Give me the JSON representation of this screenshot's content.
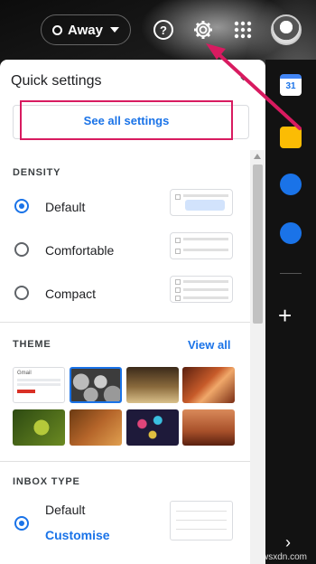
{
  "header": {
    "status_label": "Away",
    "icons": [
      "help-icon",
      "gear-icon",
      "apps-grid-icon",
      "avatar"
    ]
  },
  "side_strip": {
    "calendar_day": "31",
    "icons": [
      "calendar-icon",
      "keep-icon",
      "tasks-icon",
      "contacts-icon",
      "add-icon",
      "chevron-right-icon"
    ]
  },
  "quick_settings": {
    "title": "Quick settings",
    "see_all_label": "See all settings",
    "density": {
      "heading": "DENSITY",
      "options": [
        {
          "label": "Default",
          "selected": true
        },
        {
          "label": "Comfortable",
          "selected": false
        },
        {
          "label": "Compact",
          "selected": false
        }
      ]
    },
    "theme": {
      "heading": "THEME",
      "view_all_label": "View all",
      "tiles": [
        {
          "name": "Gmail default",
          "thumb_text": "Gmail",
          "selected": false
        },
        {
          "name": "bubbles",
          "selected": true
        },
        {
          "name": "chess",
          "selected": false
        },
        {
          "name": "canyon",
          "selected": false
        },
        {
          "name": "leaf",
          "selected": false
        },
        {
          "name": "autumn",
          "selected": false
        },
        {
          "name": "lights",
          "selected": false
        },
        {
          "name": "desert",
          "selected": false
        }
      ]
    },
    "inbox_type": {
      "heading": "INBOX TYPE",
      "option_label": "Default",
      "customise_label": "Customise",
      "selected": true
    }
  },
  "colors": {
    "accent": "#1a73e8",
    "highlight": "#d81b60"
  },
  "watermark": "wsxdn.com"
}
